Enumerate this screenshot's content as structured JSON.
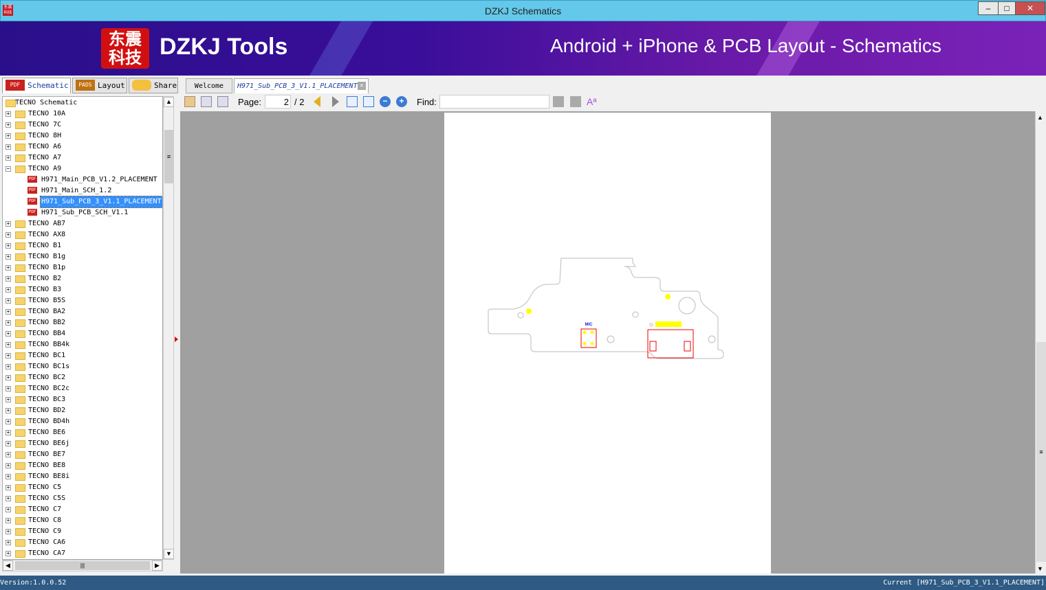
{
  "window": {
    "title": "DZKJ Schematics",
    "minimize": "–",
    "maximize": "□",
    "close": "✕"
  },
  "banner": {
    "logo_text": "东震科技",
    "brand": "DZKJ Tools",
    "slogan": "Android + iPhone & PCB Layout - Schematics"
  },
  "left_tabs": [
    {
      "label": "Schematic",
      "icon": "PDF",
      "active": true
    },
    {
      "label": "Layout",
      "icon": "PADS",
      "active": false
    },
    {
      "label": "Share",
      "icon": "cloud-add-icon",
      "active": false
    }
  ],
  "doc_tabs": [
    {
      "label": "Welcome"
    },
    {
      "label": "H971_Sub_PCB_3_V1.1_PLACEMENT",
      "active": true
    }
  ],
  "toolbar": {
    "page_label": "Page:",
    "page_value": "2",
    "page_total": "/ 2",
    "find_label": "Find:",
    "find_value": ""
  },
  "tree": {
    "root": "TECNO Schematic",
    "items": [
      {
        "label": "TECNO 10A"
      },
      {
        "label": "TECNO 7C"
      },
      {
        "label": "TECNO 8H"
      },
      {
        "label": "TECNO A6"
      },
      {
        "label": "TECNO A7"
      },
      {
        "label": "TECNO A9",
        "expanded": true,
        "children": [
          {
            "label": "H971_Main_PCB_V1.2_PLACEMENT"
          },
          {
            "label": "H971_Main_SCH_1.2"
          },
          {
            "label": "H971_Sub_PCB_3_V1.1_PLACEMENT",
            "selected": true
          },
          {
            "label": "H971_Sub_PCB_SCH_V1.1"
          }
        ]
      },
      {
        "label": "TECNO AB7"
      },
      {
        "label": "TECNO AX8"
      },
      {
        "label": "TECNO B1"
      },
      {
        "label": "TECNO B1g"
      },
      {
        "label": "TECNO B1p"
      },
      {
        "label": "TECNO B2"
      },
      {
        "label": "TECNO B3"
      },
      {
        "label": "TECNO B5S"
      },
      {
        "label": "TECNO BA2"
      },
      {
        "label": "TECNO BB2"
      },
      {
        "label": "TECNO BB4"
      },
      {
        "label": "TECNO BB4k"
      },
      {
        "label": "TECNO BC1"
      },
      {
        "label": "TECNO BC1s"
      },
      {
        "label": "TECNO BC2"
      },
      {
        "label": "TECNO BC2c"
      },
      {
        "label": "TECNO BC3"
      },
      {
        "label": "TECNO BD2"
      },
      {
        "label": "TECNO BD4h"
      },
      {
        "label": "TECNO BE6"
      },
      {
        "label": "TECNO BE6j"
      },
      {
        "label": "TECNO BE7"
      },
      {
        "label": "TECNO BE8"
      },
      {
        "label": "TECNO BE8i"
      },
      {
        "label": "TECNO C5"
      },
      {
        "label": "TECNO C5S"
      },
      {
        "label": "TECNO C7"
      },
      {
        "label": "TECNO C8"
      },
      {
        "label": "TECNO C9"
      },
      {
        "label": "TECNO CA6"
      },
      {
        "label": "TECNO CA7"
      }
    ]
  },
  "document": {
    "mic_label": "MIC"
  },
  "status": {
    "version": "Version:1.0.0.52",
    "current": "Current [H971_Sub_PCB_3_V1.1_PLACEMENT]"
  },
  "colors": {
    "titlebar": "#63c8ea",
    "status": "#2e5a84",
    "selection": "#3390ff",
    "pad": "#ffff00",
    "outline": "#e00000"
  }
}
